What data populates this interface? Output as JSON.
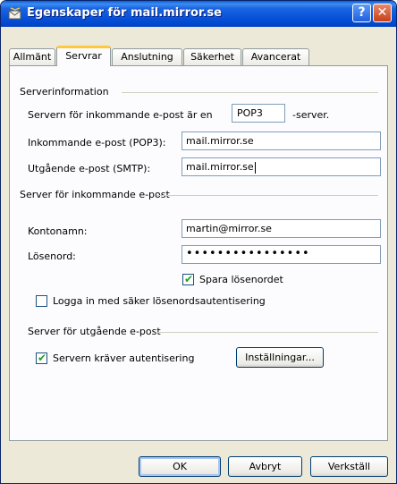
{
  "window": {
    "title": "Egenskaper för mail.mirror.se",
    "help_label": "?",
    "close_label": "✕"
  },
  "tabs": [
    {
      "label": "Allmänt",
      "active": false
    },
    {
      "label": "Servrar",
      "active": true
    },
    {
      "label": "Anslutning",
      "active": false
    },
    {
      "label": "Säkerhet",
      "active": false
    },
    {
      "label": "Avancerat",
      "active": false
    }
  ],
  "server_info": {
    "group_label": "Serverinformation",
    "incoming_type_prefix": "Servern för inkommande e-post är en",
    "incoming_type_value": "POP3",
    "incoming_type_suffix": "-server.",
    "incoming_label": "Inkommande e-post (POP3):",
    "incoming_value": "mail.mirror.se",
    "outgoing_label": "Utgående e-post (SMTP):",
    "outgoing_value": "mail.mirror.se"
  },
  "incoming_server": {
    "group_label": "Server för inkommande e-post",
    "account_label": "Kontonamn:",
    "account_value": "martin@mirror.se",
    "password_label": "Lösenord:",
    "password_value": "••••••••••••••••",
    "save_password_label": "Spara lösenordet",
    "save_password_checked": true,
    "spa_label": "Logga in med säker lösenordsautentisering",
    "spa_checked": false
  },
  "outgoing_server": {
    "group_label": "Server för utgående e-post",
    "auth_label": "Servern kräver autentisering",
    "auth_checked": true,
    "settings_button": "Inställningar..."
  },
  "buttons": {
    "ok": "OK",
    "cancel": "Avbryt",
    "apply": "Verkställ"
  },
  "colors": {
    "titlebar": "#0550d8",
    "dialog_bg": "#ece9d8",
    "active_tab_accent": "#ffc83c",
    "check_mark": "#21a121"
  }
}
